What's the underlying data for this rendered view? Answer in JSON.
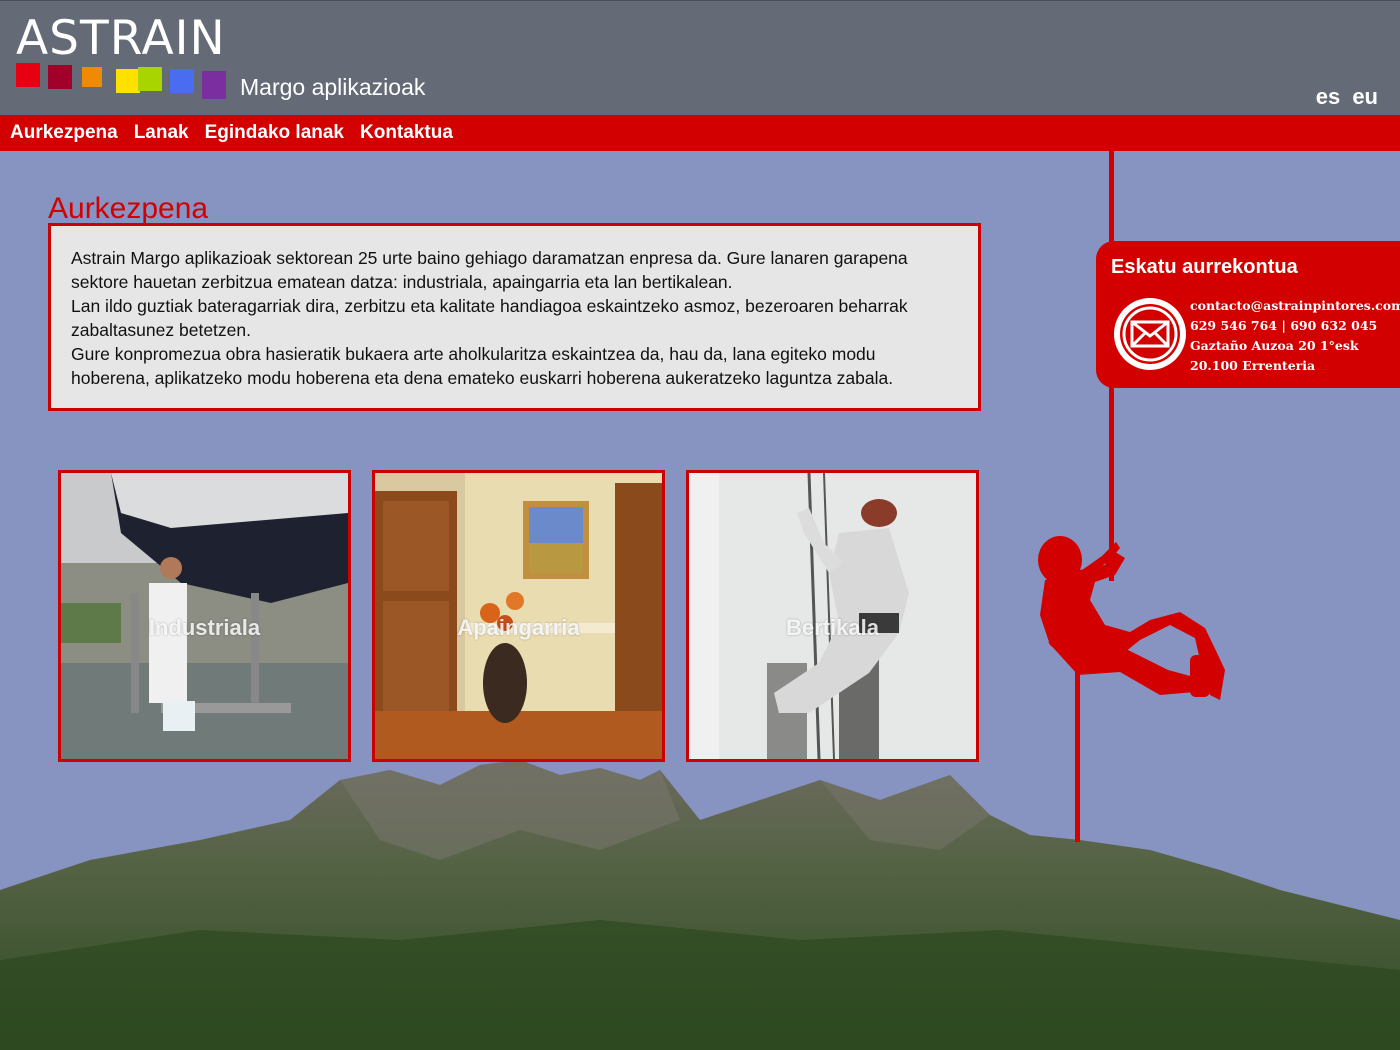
{
  "header": {
    "logo": "ASTRAIN",
    "subtitle": "Margo aplikazioak",
    "swatch_colors": [
      "#e60012",
      "#a0002a",
      "#f08a00",
      "#ffe100",
      "#a8d400",
      "#4a6cf0",
      "#7b2ea0"
    ],
    "languages": [
      "es",
      "eu"
    ]
  },
  "nav": {
    "items": [
      "Aurkezpena",
      "Lanak",
      "Egindako lanak",
      "Kontaktua"
    ]
  },
  "intro": {
    "title": "Aurkezpena",
    "paragraphs": [
      "Astrain Margo aplikazioak sektorean 25 urte baino gehiago daramatzan enpresa da. Gure lanaren garapena sektore hauetan zerbitzua ematean datza: industriala, apaingarria eta lan bertikalean.",
      "Lan ildo guztiak bateragarriak dira, zerbitzu eta kalitate handiagoa eskaintzeko asmoz, bezeroaren beharrak zabaltasunez betetzen.",
      "Gure konpromezua obra hasieratik bukaera arte aholkularitza eskaintzea da, hau da, lana egiteko modu hoberena, aplikatzeko modu hoberena eta dena emateko euskarri hoberena aukeratzeko laguntza zabala."
    ]
  },
  "cards": [
    {
      "label": "Industriala"
    },
    {
      "label": "Apaingarria"
    },
    {
      "label": "Bertikala"
    }
  ],
  "quote": {
    "title": "Eskatu aurrekontua",
    "email": "contacto@astrainpintores.com",
    "phones": "629 546 764 | 690 632 045",
    "address": "Gaztaño Auzoa 20 1°esk",
    "city": "20.100 Errenteria",
    "icon": "envelope-icon"
  },
  "colors": {
    "accent": "#d30000",
    "header_bg": "#656a77",
    "page_bg": "#8793c1"
  }
}
